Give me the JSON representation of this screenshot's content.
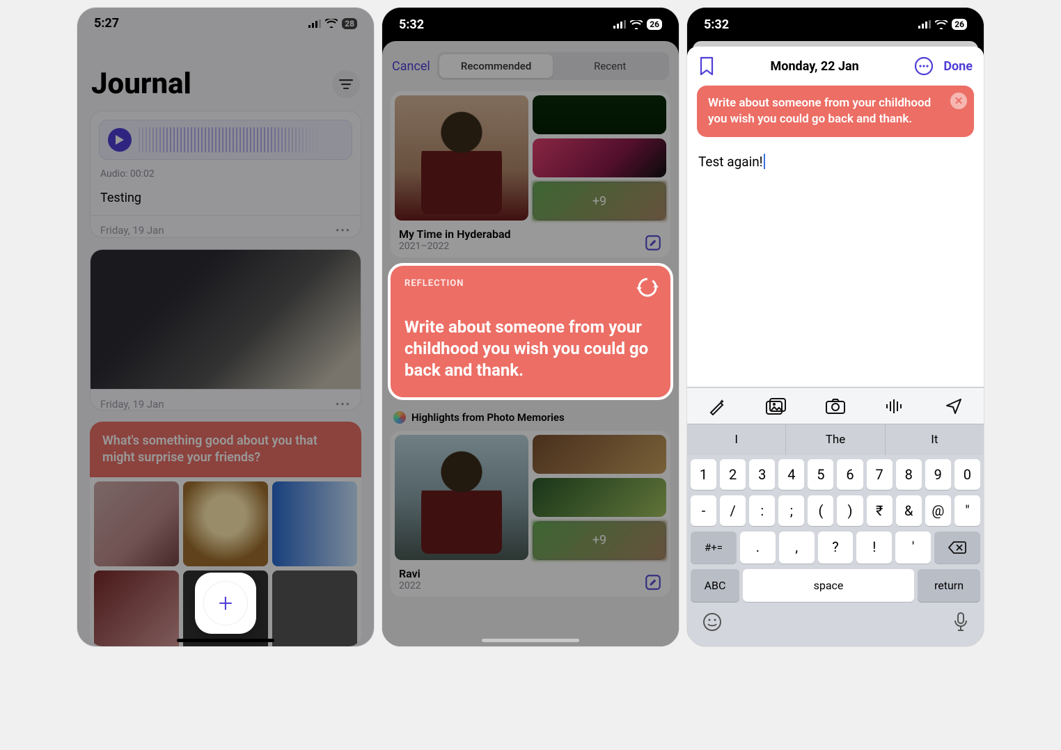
{
  "screen1": {
    "status": {
      "time": "5:27",
      "battery": "28"
    },
    "title": "Journal",
    "entry1": {
      "audio_label": "Audio: 00:02",
      "title": "Testing",
      "date": "Friday, 19 Jan"
    },
    "entry2": {
      "date": "Friday, 19 Jan"
    },
    "prompt": "What's something good about you that might surprise your friends?"
  },
  "screen2": {
    "status": {
      "time": "5:32",
      "battery": "26"
    },
    "cancel": "Cancel",
    "seg_recommended": "Recommended",
    "seg_recent": "Recent",
    "moment1": {
      "title": "My Time in Hyderabad",
      "subtitle": "2021–2022",
      "more": "+9"
    },
    "reflection": {
      "label": "REFLECTION",
      "text": "Write about someone from your childhood you wish you could go back and thank."
    },
    "section_label": "Highlights from Photo Memories",
    "moment2": {
      "title": "Ravi",
      "subtitle": "2022",
      "more": "+9"
    }
  },
  "screen3": {
    "status": {
      "time": "5:32",
      "battery": "26"
    },
    "date": "Monday, 22 Jan",
    "done": "Done",
    "prompt": "Write about someone from your childhood you wish you could go back and thank.",
    "body": "Test again!",
    "quick": [
      "I",
      "The",
      "It"
    ],
    "row1": [
      "1",
      "2",
      "3",
      "4",
      "5",
      "6",
      "7",
      "8",
      "9",
      "0"
    ],
    "row2": [
      "-",
      "/",
      ":",
      ";",
      "(",
      ")",
      "₹",
      "&",
      "@",
      "″"
    ],
    "shift": "#+=",
    "row3": [
      ".",
      ",",
      "?",
      "!",
      "′"
    ],
    "abc": "ABC",
    "space": "space",
    "ret": "return"
  }
}
